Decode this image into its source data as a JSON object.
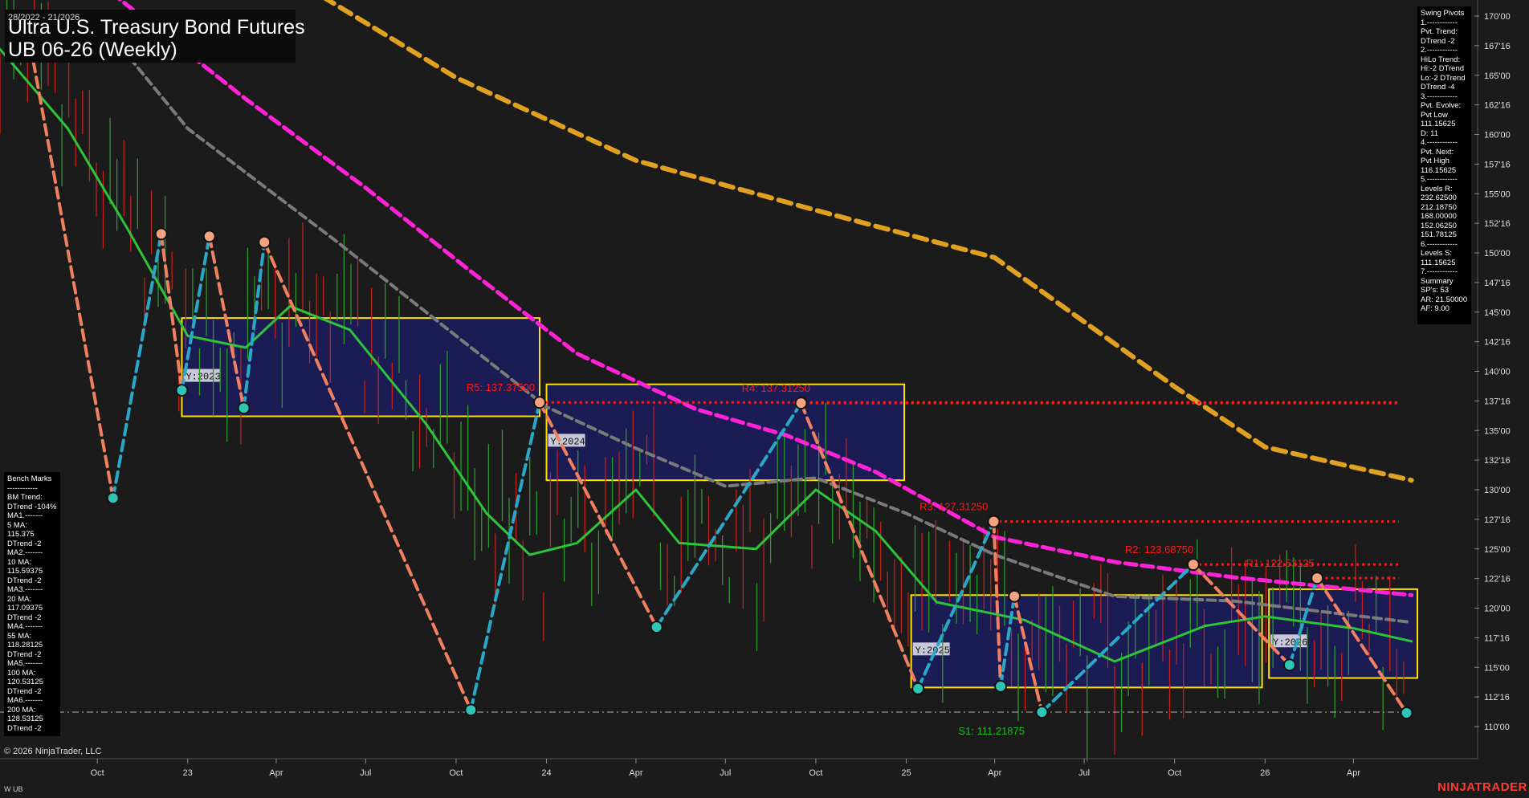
{
  "header": {
    "date_range": "28/2022 - 21/2026",
    "title_line1": "Ultra U.S. Treasury Bond Futures",
    "title_line2": "UB 06-26 (Weekly)"
  },
  "swing_pivots": [
    "Swing Pivots",
    "1.------------",
    "Pvt. Trend:",
    "DTrend -2",
    "2.------------",
    "HiLo Trend:",
    "Hi:-2 DTrend",
    "Lo:-2 DTrend",
    "DTrend -4",
    "3.------------",
    "Pvt. Evolve:",
    "Pvt Low",
    "111.15625",
    "D: 11",
    "4.------------",
    "Pvt. Next:",
    "Pvt High",
    "116.15625",
    "5.------------",
    "Levels R:",
    "232.62500",
    "212.18750",
    "168.00000",
    "152.06250",
    "151.78125",
    "6.------------",
    "Levels S:",
    "111.15625",
    "7.------------",
    "Summary",
    "SP's: 53",
    "AR: 21.50000",
    "AF: 9.00"
  ],
  "bench_marks": [
    "Bench Marks",
    "------------",
    "BM Trend:",
    "DTrend -104%",
    "MA1.-------",
    "5 MA:",
    "115.375",
    "DTrend -2",
    "MA2.-------",
    "10 MA:",
    "115.59375",
    "DTrend -2",
    "MA3.-------",
    "20 MA:",
    "117.09375",
    "DTrend -2",
    "MA4.-------",
    "55 MA:",
    "118.28125",
    "DTrend -2",
    "MA5.-------",
    "100 MA:",
    "120.53125",
    "DTrend -2",
    "MA6.-------",
    "200 MA:",
    "128.53125",
    "DTrend -2"
  ],
  "footer": {
    "copyright": "© 2026 NinjaTrader, LLC",
    "instrument": "W UB",
    "brand": "NINJATRADER"
  },
  "colors": {
    "background": "#1b1b1b",
    "pivot_high": "#f4a27f",
    "pivot_low": "#2ec4b6",
    "swing_up": "#2aa8c8",
    "swing_down": "#f08060",
    "magenta_ma": "#ff22d6",
    "orange_ma": "#e0a020",
    "gray_ma": "#7a7a7a",
    "green_ma": "#2ec43a",
    "resistance": "#ff1a1a",
    "support_text": "#22b822",
    "box_fill": "#1c1c5e",
    "box_border": "#ffe000"
  },
  "chart_data": {
    "type": "candlestick",
    "title": "Ultra U.S. Treasury Bond Futures",
    "ylim": [
      110.0,
      170.0
    ],
    "y_ticks": [
      "170'00",
      "167'16",
      "165'00",
      "162'16",
      "160'00",
      "157'16",
      "155'00",
      "152'16",
      "150'00",
      "147'16",
      "145'00",
      "142'16",
      "140'00",
      "137'16",
      "135'00",
      "132'16",
      "130'00",
      "127'16",
      "125'00",
      "122'16",
      "120'00",
      "117'16",
      "115'00",
      "112'16",
      "110'00"
    ],
    "x_ticks": [
      {
        "label": "Oct",
        "date": "2022-10-01"
      },
      {
        "label": "23",
        "date": "2023-01-01"
      },
      {
        "label": "Apr",
        "date": "2023-04-01"
      },
      {
        "label": "Jul",
        "date": "2023-07-01"
      },
      {
        "label": "Oct",
        "date": "2023-10-01"
      },
      {
        "label": "24",
        "date": "2024-01-01"
      },
      {
        "label": "Apr",
        "date": "2024-04-01"
      },
      {
        "label": "Jul",
        "date": "2024-07-01"
      },
      {
        "label": "Oct",
        "date": "2024-10-01"
      },
      {
        "label": "25",
        "date": "2025-01-01"
      },
      {
        "label": "Apr",
        "date": "2025-04-01"
      },
      {
        "label": "Jul",
        "date": "2025-07-01"
      },
      {
        "label": "Oct",
        "date": "2025-10-01"
      },
      {
        "label": "26",
        "date": "2026-01-01"
      },
      {
        "label": "Apr",
        "date": "2026-04-01"
      }
    ],
    "x_range": [
      "2022-06-24",
      "2026-06-05"
    ],
    "resistance_levels": [
      {
        "label": "R5: 137.37500",
        "value": 137.375,
        "start": "2023-12-20"
      },
      {
        "label": "R4: 137.31250",
        "value": 137.3125,
        "start": "2024-09-25"
      },
      {
        "label": "R3: 127.31250",
        "value": 127.3125,
        "start": "2025-03-25"
      },
      {
        "label": "R2: 123.68750",
        "value": 123.6875,
        "start": "2025-10-20"
      },
      {
        "label": "R1: 122.53125",
        "value": 122.53125,
        "start": "2026-02-20"
      }
    ],
    "support_levels": [
      {
        "label": "S1: 111.21875",
        "value": 111.21875,
        "start": "2025-06-01"
      }
    ],
    "year_boxes": [
      {
        "label": "Y:2023",
        "start": "2022-12-26",
        "end": "2023-12-25",
        "high": 144.5,
        "low": 136.2
      },
      {
        "label": "Y:2024",
        "start": "2024-01-01",
        "end": "2024-12-30",
        "high": 138.9,
        "low": 130.8
      },
      {
        "label": "Y:2025",
        "start": "2025-01-06",
        "end": "2025-12-29",
        "high": 121.1,
        "low": 113.3
      },
      {
        "label": "Y:2026",
        "start": "2026-01-05",
        "end": "2026-06-05",
        "high": 121.6,
        "low": 114.1
      }
    ],
    "swing_pivots": [
      {
        "date": "2022-07-25",
        "price": 167.5,
        "kind": "high"
      },
      {
        "date": "2022-10-17",
        "price": 129.3,
        "kind": "low"
      },
      {
        "date": "2022-12-05",
        "price": 151.6,
        "kind": "high"
      },
      {
        "date": "2022-12-26",
        "price": 138.4,
        "kind": "low"
      },
      {
        "date": "2023-01-23",
        "price": 151.4,
        "kind": "high"
      },
      {
        "date": "2023-02-27",
        "price": 136.9,
        "kind": "low"
      },
      {
        "date": "2023-03-20",
        "price": 150.9,
        "kind": "high"
      },
      {
        "date": "2023-10-16",
        "price": 111.4,
        "kind": "low"
      },
      {
        "date": "2023-12-25",
        "price": 137.375,
        "kind": "high"
      },
      {
        "date": "2024-04-22",
        "price": 118.4,
        "kind": "low"
      },
      {
        "date": "2024-09-16",
        "price": 137.3125,
        "kind": "high"
      },
      {
        "date": "2025-01-13",
        "price": 113.2,
        "kind": "low"
      },
      {
        "date": "2025-03-31",
        "price": 127.3125,
        "kind": "high"
      },
      {
        "date": "2025-04-07",
        "price": 113.4,
        "kind": "low"
      },
      {
        "date": "2025-04-21",
        "price": 121.0,
        "kind": "high"
      },
      {
        "date": "2025-05-19",
        "price": 111.21875,
        "kind": "low"
      },
      {
        "date": "2025-10-20",
        "price": 123.6875,
        "kind": "high"
      },
      {
        "date": "2026-01-26",
        "price": 115.2,
        "kind": "low"
      },
      {
        "date": "2026-02-23",
        "price": 122.53125,
        "kind": "high"
      },
      {
        "date": "2026-05-25",
        "price": 111.15625,
        "kind": "low"
      }
    ],
    "moving_averages": [
      {
        "name": "orange",
        "points": [
          [
            "2023-05-01",
            172.5
          ],
          [
            "2023-10-01",
            164.8
          ],
          [
            "2024-04-01",
            157.8
          ],
          [
            "2024-10-01",
            153.6
          ],
          [
            "2025-04-01",
            149.6
          ],
          [
            "2025-10-01",
            138.7
          ],
          [
            "2026-01-01",
            133.6
          ],
          [
            "2026-05-30",
            130.8
          ]
        ]
      },
      {
        "name": "magenta",
        "points": [
          [
            "2022-10-15",
            172.0
          ],
          [
            "2023-03-01",
            163.0
          ],
          [
            "2023-07-01",
            155.5
          ],
          [
            "2023-10-15",
            148.5
          ],
          [
            "2024-02-01",
            141.5
          ],
          [
            "2024-06-01",
            136.8
          ],
          [
            "2024-09-01",
            134.6
          ],
          [
            "2024-12-01",
            131.5
          ],
          [
            "2025-04-01",
            126.0
          ],
          [
            "2025-08-01",
            123.9
          ],
          [
            "2025-12-01",
            122.6
          ],
          [
            "2026-05-30",
            121.1
          ]
        ]
      },
      {
        "name": "gray",
        "points": [
          [
            "2022-10-01",
            169.8
          ],
          [
            "2023-01-01",
            160.5
          ],
          [
            "2023-06-01",
            151.0
          ],
          [
            "2023-10-01",
            143.0
          ],
          [
            "2024-01-01",
            137.0
          ],
          [
            "2024-04-01",
            133.5
          ],
          [
            "2024-07-01",
            130.3
          ],
          [
            "2024-10-01",
            131.0
          ],
          [
            "2025-01-01",
            128.0
          ],
          [
            "2025-04-01",
            124.5
          ],
          [
            "2025-08-01",
            121.0
          ],
          [
            "2025-12-01",
            120.6
          ],
          [
            "2026-05-30",
            118.8
          ]
        ]
      },
      {
        "name": "green",
        "points": [
          [
            "2022-06-24",
            167.2
          ],
          [
            "2022-09-01",
            160.5
          ],
          [
            "2022-11-01",
            152.0
          ],
          [
            "2023-01-01",
            143.0
          ],
          [
            "2023-03-01",
            142.0
          ],
          [
            "2023-04-15",
            145.5
          ],
          [
            "2023-06-15",
            143.5
          ],
          [
            "2023-09-01",
            135.5
          ],
          [
            "2023-11-01",
            128.0
          ],
          [
            "2023-12-15",
            124.5
          ],
          [
            "2024-02-01",
            125.5
          ],
          [
            "2024-04-01",
            130.0
          ],
          [
            "2024-05-15",
            125.5
          ],
          [
            "2024-08-01",
            125.0
          ],
          [
            "2024-10-01",
            130.0
          ],
          [
            "2024-12-01",
            126.5
          ],
          [
            "2025-02-01",
            120.5
          ],
          [
            "2025-05-01",
            119.0
          ],
          [
            "2025-08-01",
            115.5
          ],
          [
            "2025-11-01",
            118.5
          ],
          [
            "2026-01-01",
            119.3
          ],
          [
            "2026-04-01",
            118.3
          ],
          [
            "2026-05-30",
            117.2
          ]
        ]
      }
    ],
    "candles": "weekly OHLC bars (red = down, green = up) omitted as unreadable individually"
  }
}
